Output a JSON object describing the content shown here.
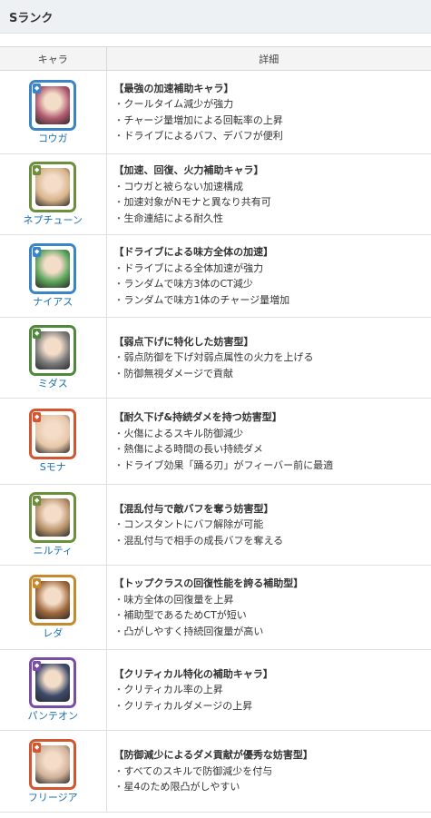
{
  "section": {
    "title": "Sランク"
  },
  "table": {
    "headers": {
      "chara": "キャラ",
      "detail": "詳細"
    },
    "rows": [
      {
        "name": "コウガ",
        "title": "【最強の加速補助キャラ】",
        "points": [
          "クールタイム減少が強力",
          "チャージ量増加による回転率の上昇",
          "ドライブによるバフ、デバフが便利"
        ],
        "frame": "#3a85c8",
        "face": "#b05a6e"
      },
      {
        "name": "ネプチューン",
        "title": "【加速、回復、火力補助キャラ】",
        "points": [
          "コウガと被らない加速構成",
          "加速対象がNモナと異なり共有可",
          "生命連結による耐久性"
        ],
        "frame": "#6b8f3a",
        "face": "#d8b48a"
      },
      {
        "name": "ナイアス",
        "title": "【ドライブによる味方全体の加速】",
        "points": [
          "ドライブによる全体加速が強力",
          "ランダムで味方3体のCT減少",
          "ランダムで味方1体のチャージ量増加"
        ],
        "frame": "#3a85c8",
        "face": "#5aa35a"
      },
      {
        "name": "ミダス",
        "title": "【弱点下げに特化した妨害型】",
        "points": [
          "弱点防御を下げ対弱点属性の火力を上げる",
          "防御無視ダメージで貢献"
        ],
        "frame": "#4f8a3c",
        "face": "#7a7a7a"
      },
      {
        "name": "Sモナ",
        "title": "【耐久下げ&持続ダメを持つ妨害型】",
        "points": [
          "火傷によるスキル防御減少",
          "熱傷による時間の長い持続ダメ",
          "ドライブ効果「踊る刃」がフィーバー前に最適"
        ],
        "frame": "#d2562f",
        "face": "#e6c6a8"
      },
      {
        "name": "ニルティ",
        "title": "【混乱付与で敵バフを奪う妨害型】",
        "points": [
          "コンスタントにバフ解除が可能",
          "混乱付与で相手の成長バフを奪える"
        ],
        "frame": "#6b8f3a",
        "face": "#b8926a"
      },
      {
        "name": "レダ",
        "title": "【トップクラスの回復性能を誇る補助型】",
        "points": [
          "味方全体の回復量を上昇",
          "補助型であるためCTが短い",
          "凸がしやすく持続回復量が高い"
        ],
        "frame": "#c58a2e",
        "face": "#a0683c"
      },
      {
        "name": "パンテオン",
        "title": "【クリティカル特化の補助キャラ】",
        "points": [
          "クリティカル率の上昇",
          "クリティカルダメージの上昇"
        ],
        "frame": "#7a4fa3",
        "face": "#3c4a6a"
      },
      {
        "name": "フリージア",
        "title": "【防御減少によるダメ貢献が優秀な妨害型】",
        "points": [
          "すべてのスキルで防御減少を付与",
          "星4のため限凸がしやすい"
        ],
        "frame": "#d2562f",
        "face": "#d0b098"
      }
    ]
  }
}
